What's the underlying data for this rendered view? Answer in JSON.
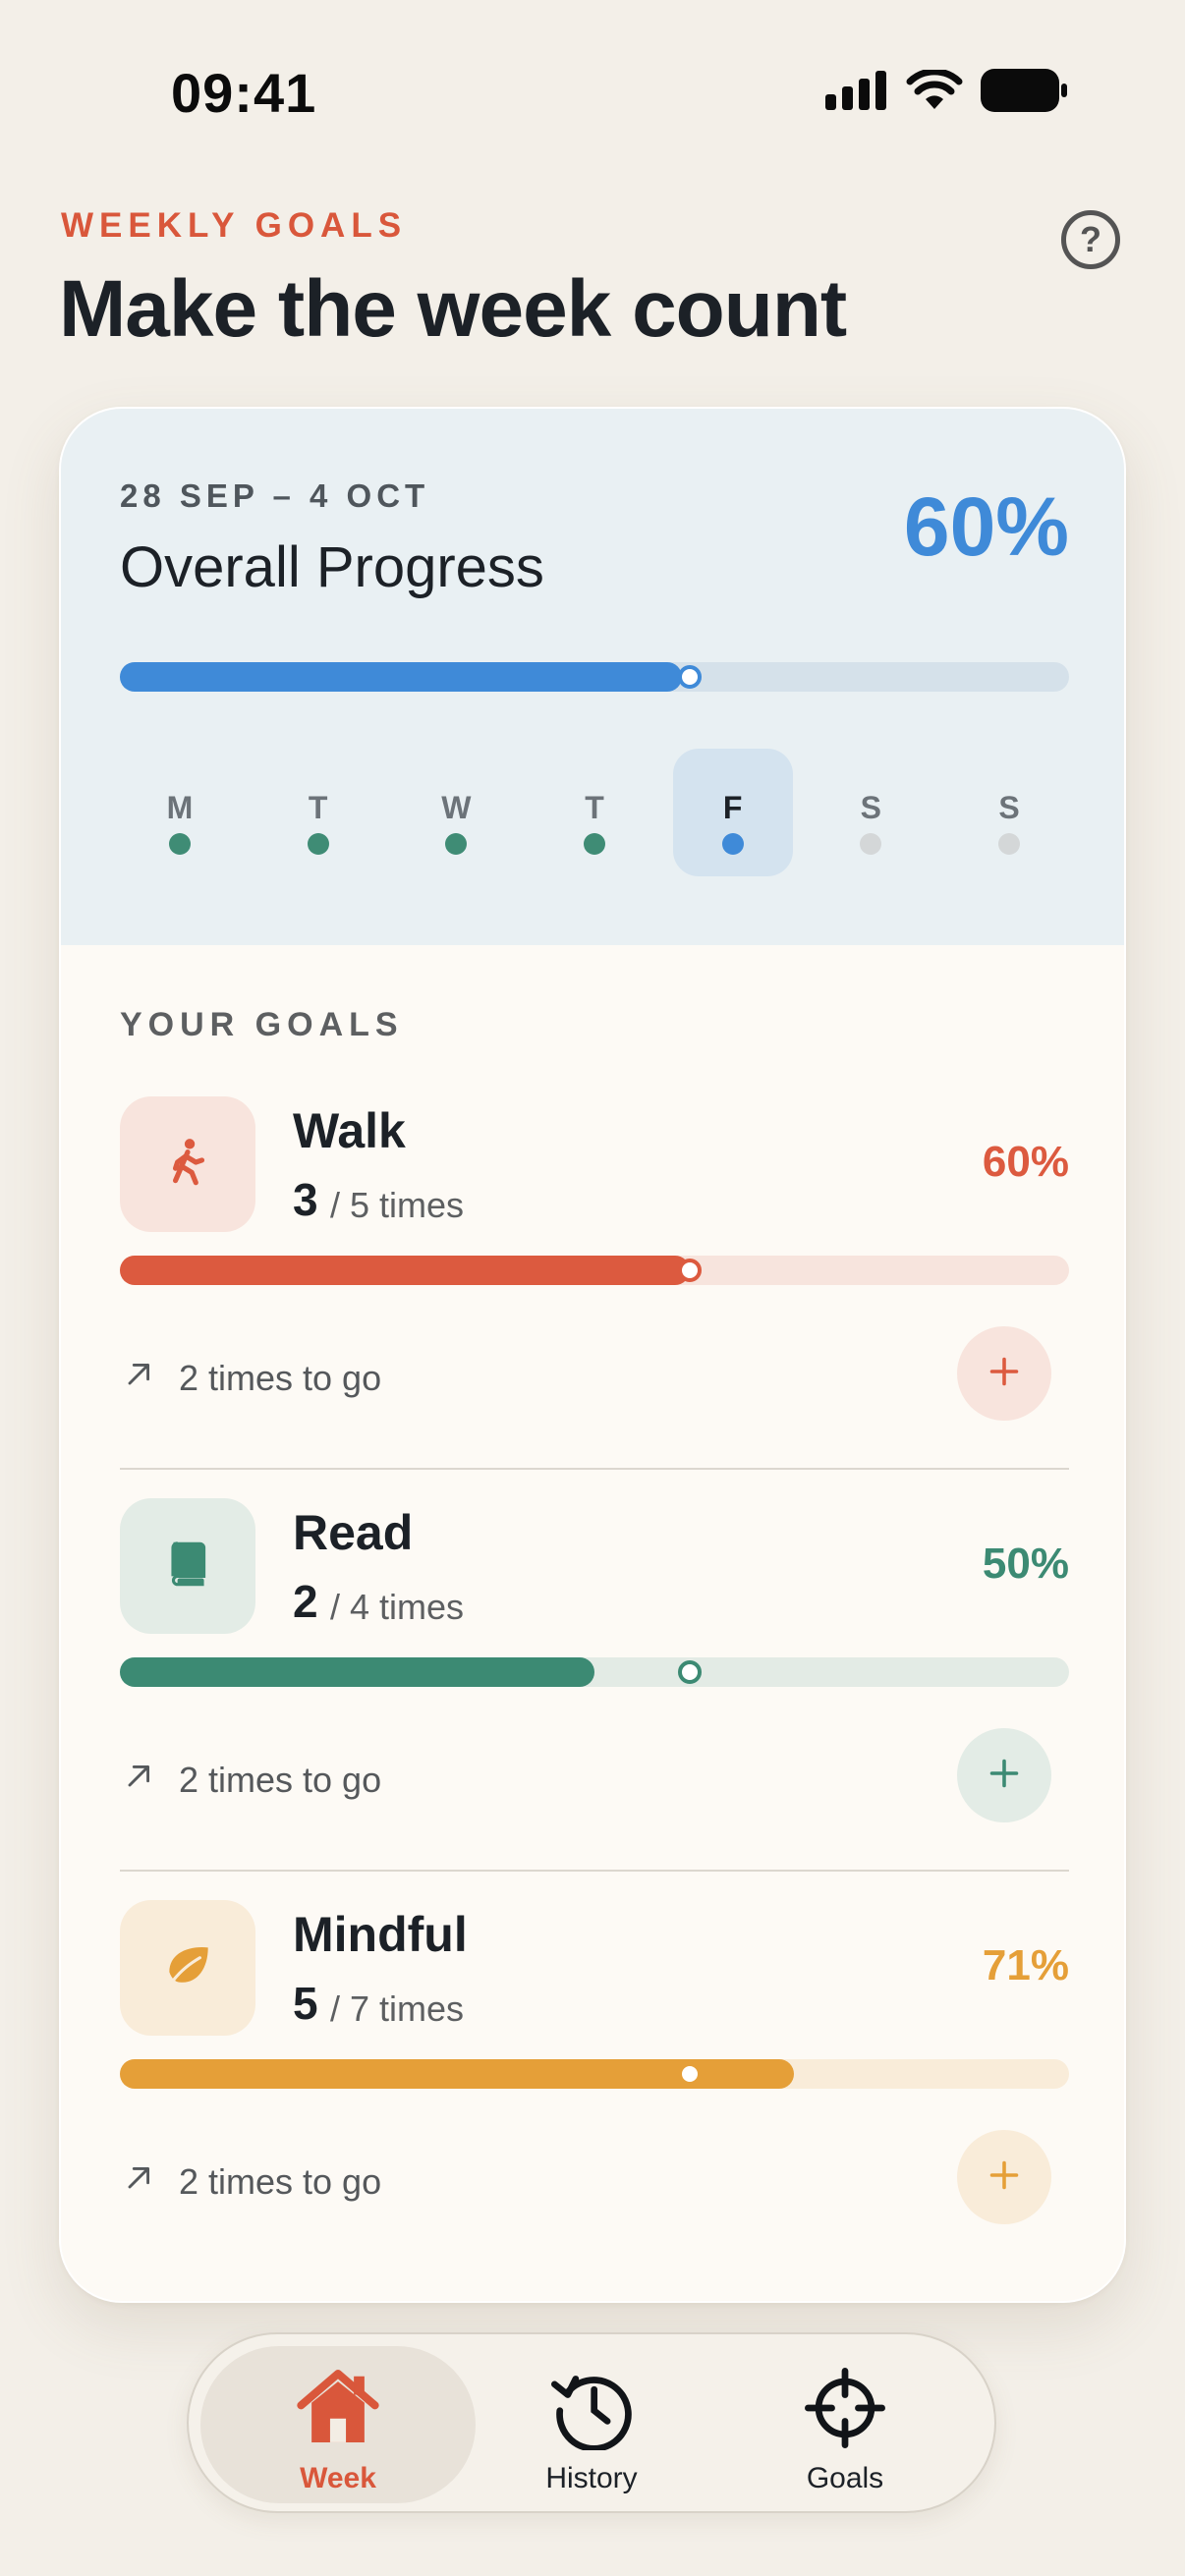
{
  "status_bar": {
    "time": "09:41"
  },
  "header": {
    "eyebrow": "WEEKLY GOALS",
    "title": "Make the week count",
    "help_label": "?"
  },
  "overview": {
    "date_range": "28 SEP – 4 OCT",
    "label": "Overall Progress",
    "percent_text": "60%",
    "progress": 0.6,
    "days": [
      {
        "letter": "M",
        "done": true,
        "current": false
      },
      {
        "letter": "T",
        "done": true,
        "current": false
      },
      {
        "letter": "W",
        "done": true,
        "current": false
      },
      {
        "letter": "T",
        "done": true,
        "current": false
      },
      {
        "letter": "F",
        "done": true,
        "current": true
      },
      {
        "letter": "S",
        "done": false,
        "current": false
      },
      {
        "letter": "S",
        "done": false,
        "current": false
      }
    ],
    "colors": {
      "accent": "#3f8ad8",
      "track": "#d5e1ea",
      "done_dot": "#3f8c75",
      "pending_dot": "#d4d7d8"
    }
  },
  "goals_heading": "YOUR GOALS",
  "goals": [
    {
      "name": "Walk",
      "icon": "walking-icon",
      "done": "3",
      "target_text": "/ 5 times",
      "percent_text": "60%",
      "progress": 0.6,
      "remaining": "2 times to go",
      "colors": {
        "accent": "#dc5a3f",
        "soft": "#f8e4dd",
        "track": "#f7e4dd"
      }
    },
    {
      "name": "Read",
      "icon": "book-icon",
      "done": "2",
      "target_text": "/ 4 times",
      "percent_text": "50%",
      "progress": 0.5,
      "remaining": "2 times to go",
      "colors": {
        "accent": "#3c8a73",
        "soft": "#e3ece6",
        "track": "#e3ebe5"
      }
    },
    {
      "name": "Mindful",
      "icon": "leaf-icon",
      "done": "5",
      "target_text": "/ 7 times",
      "percent_text": "71%",
      "progress": 0.71,
      "remaining": "2 times to go",
      "colors": {
        "accent": "#e59f38",
        "soft": "#f9ecd9",
        "track": "#f9ecd9"
      }
    }
  ],
  "tab_bar": {
    "tabs": [
      {
        "label": "Week",
        "icon": "home-icon",
        "active": true
      },
      {
        "label": "History",
        "icon": "history-icon",
        "active": false
      },
      {
        "label": "Goals",
        "icon": "target-icon",
        "active": false
      }
    ],
    "active_color": "#d9573b"
  }
}
